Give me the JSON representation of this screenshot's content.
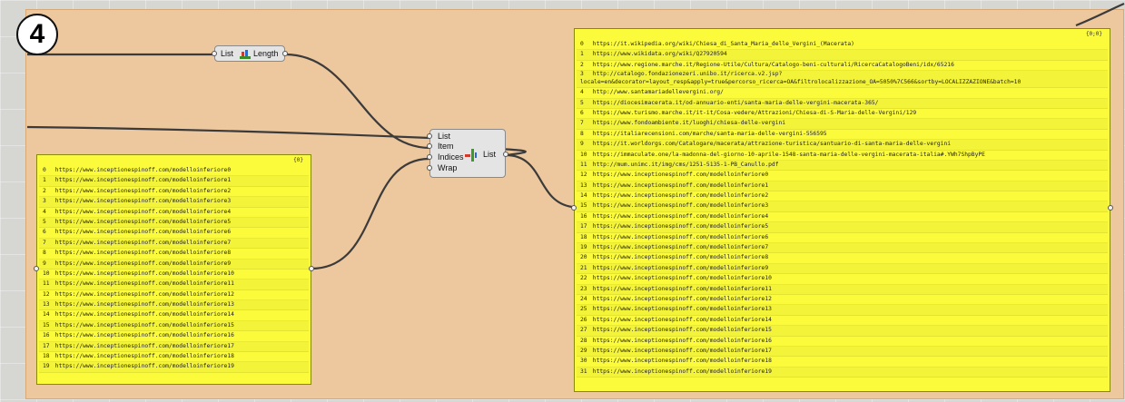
{
  "step_badge": "4",
  "list_length": {
    "left_label": "List",
    "right_label": "Length"
  },
  "list_item": {
    "inputs": [
      "List",
      "Item",
      "Indices",
      "Wrap"
    ],
    "output": "List"
  },
  "left_panel": {
    "path": "{0}",
    "rows": [
      {
        "i": "0",
        "t": "https://www.inceptionespinoff.com/modelloinferiore0"
      },
      {
        "i": "1",
        "t": "https://www.inceptionespinoff.com/modelloinferiore1"
      },
      {
        "i": "2",
        "t": "https://www.inceptionespinoff.com/modelloinferiore2"
      },
      {
        "i": "3",
        "t": "https://www.inceptionespinoff.com/modelloinferiore3"
      },
      {
        "i": "4",
        "t": "https://www.inceptionespinoff.com/modelloinferiore4"
      },
      {
        "i": "5",
        "t": "https://www.inceptionespinoff.com/modelloinferiore5"
      },
      {
        "i": "6",
        "t": "https://www.inceptionespinoff.com/modelloinferiore6"
      },
      {
        "i": "7",
        "t": "https://www.inceptionespinoff.com/modelloinferiore7"
      },
      {
        "i": "8",
        "t": "https://www.inceptionespinoff.com/modelloinferiore8"
      },
      {
        "i": "9",
        "t": "https://www.inceptionespinoff.com/modelloinferiore9"
      },
      {
        "i": "10",
        "t": "https://www.inceptionespinoff.com/modelloinferiore10"
      },
      {
        "i": "11",
        "t": "https://www.inceptionespinoff.com/modelloinferiore11"
      },
      {
        "i": "12",
        "t": "https://www.inceptionespinoff.com/modelloinferiore12"
      },
      {
        "i": "13",
        "t": "https://www.inceptionespinoff.com/modelloinferiore13"
      },
      {
        "i": "14",
        "t": "https://www.inceptionespinoff.com/modelloinferiore14"
      },
      {
        "i": "15",
        "t": "https://www.inceptionespinoff.com/modelloinferiore15"
      },
      {
        "i": "16",
        "t": "https://www.inceptionespinoff.com/modelloinferiore16"
      },
      {
        "i": "17",
        "t": "https://www.inceptionespinoff.com/modelloinferiore17"
      },
      {
        "i": "18",
        "t": "https://www.inceptionespinoff.com/modelloinferiore18"
      },
      {
        "i": "19",
        "t": "https://www.inceptionespinoff.com/modelloinferiore19"
      }
    ]
  },
  "right_panel": {
    "path": "{0;0}",
    "rows": [
      {
        "i": "0",
        "t": "https://it.wikipedia.org/wiki/Chiesa_di_Santa_Maria_delle_Vergini_(Macerata)"
      },
      {
        "i": "1",
        "t": "https://www.wikidata.org/wiki/Q27920594"
      },
      {
        "i": "2",
        "t": "https://www.regione.marche.it/Regione-Utile/Cultura/Catalogo-beni-culturali/RicercaCatalogoBeni/idx/65216"
      },
      {
        "i": "3",
        "t": "http://catalogo.fondazionezeri.unibo.it/ricerca.v2.jsp?locale=en&decorator=layout_resp&apply=true&percorso_ricerca=OA&filtrolocalizzazione_OA=5050%7C566&sortby=LOCALIZZAZIONE&batch=10"
      },
      {
        "i": "4",
        "t": "http://www.santamariadellevergini.org/"
      },
      {
        "i": "5",
        "t": "https://diocesimacerata.it/od-annuario-enti/santa-maria-delle-vergini-macerata-365/"
      },
      {
        "i": "6",
        "t": "https://www.turismo.marche.it/it-it/Cosa-vedere/Attrazioni/Chiesa-di-S-Maria-delle-Vergini/129"
      },
      {
        "i": "7",
        "t": "https://www.fondoambiente.it/luoghi/chiesa-delle-vergini"
      },
      {
        "i": "8",
        "t": "https://italiarecensioni.com/marche/santa-maria-delle-vergini-556595"
      },
      {
        "i": "9",
        "t": "https://it.worldorgs.com/Catalogare/macerata/attrazione-turistica/santuario-di-santa-maria-delle-vergini"
      },
      {
        "i": "10",
        "t": "https://immaculate.one/la-madonna-del-giorno-10-aprile-1548-santa-maria-delle-vergini-macerata-italia#.YWh7ShpByPE"
      },
      {
        "i": "11",
        "t": "http://mum.unimc.it/img/cms/1251-5135-1-PB_Canullo.pdf"
      },
      {
        "i": "12",
        "t": "https://www.inceptionespinoff.com/modelloinferiore0"
      },
      {
        "i": "13",
        "t": "https://www.inceptionespinoff.com/modelloinferiore1"
      },
      {
        "i": "14",
        "t": "https://www.inceptionespinoff.com/modelloinferiore2"
      },
      {
        "i": "15",
        "t": "https://www.inceptionespinoff.com/modelloinferiore3"
      },
      {
        "i": "16",
        "t": "https://www.inceptionespinoff.com/modelloinferiore4"
      },
      {
        "i": "17",
        "t": "https://www.inceptionespinoff.com/modelloinferiore5"
      },
      {
        "i": "18",
        "t": "https://www.inceptionespinoff.com/modelloinferiore6"
      },
      {
        "i": "19",
        "t": "https://www.inceptionespinoff.com/modelloinferiore7"
      },
      {
        "i": "20",
        "t": "https://www.inceptionespinoff.com/modelloinferiore8"
      },
      {
        "i": "21",
        "t": "https://www.inceptionespinoff.com/modelloinferiore9"
      },
      {
        "i": "22",
        "t": "https://www.inceptionespinoff.com/modelloinferiore10"
      },
      {
        "i": "23",
        "t": "https://www.inceptionespinoff.com/modelloinferiore11"
      },
      {
        "i": "24",
        "t": "https://www.inceptionespinoff.com/modelloinferiore12"
      },
      {
        "i": "25",
        "t": "https://www.inceptionespinoff.com/modelloinferiore13"
      },
      {
        "i": "26",
        "t": "https://www.inceptionespinoff.com/modelloinferiore14"
      },
      {
        "i": "27",
        "t": "https://www.inceptionespinoff.com/modelloinferiore15"
      },
      {
        "i": "28",
        "t": "https://www.inceptionespinoff.com/modelloinferiore16"
      },
      {
        "i": "29",
        "t": "https://www.inceptionespinoff.com/modelloinferiore17"
      },
      {
        "i": "30",
        "t": "https://www.inceptionespinoff.com/modelloinferiore18"
      },
      {
        "i": "31",
        "t": "https://www.inceptionespinoff.com/modelloinferiore19"
      }
    ]
  },
  "colors": {
    "group": "#edc79d",
    "panel": "#fbfb3c",
    "wire": "#3b3b3b",
    "canvas": "#d6d6d2"
  }
}
